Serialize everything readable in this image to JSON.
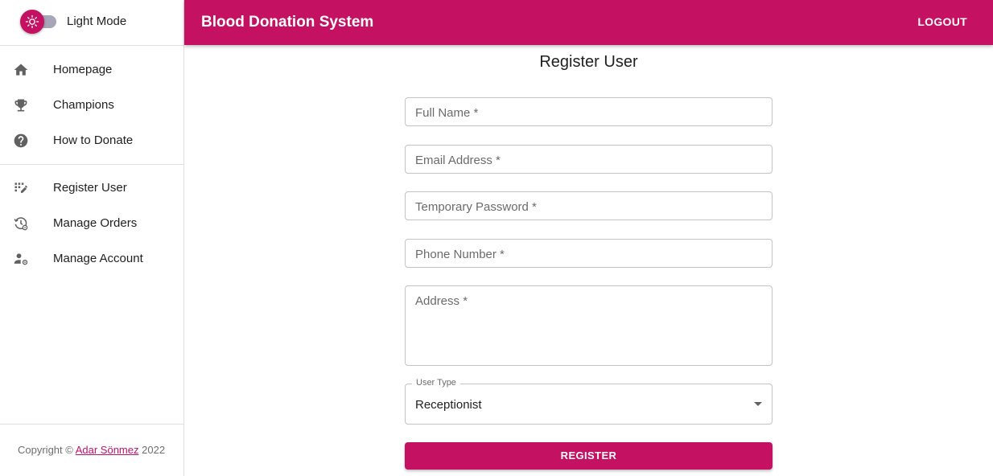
{
  "theme": {
    "label": "Light Mode",
    "icon": "sun-icon"
  },
  "sidebar": {
    "primary_items": [
      {
        "label": "Homepage",
        "icon": "home-icon"
      },
      {
        "label": "Champions",
        "icon": "trophy-icon"
      },
      {
        "label": "How to Donate",
        "icon": "help-circle-icon"
      }
    ],
    "secondary_items": [
      {
        "label": "Register User",
        "icon": "app-registration-icon"
      },
      {
        "label": "Manage Orders",
        "icon": "history-settings-icon"
      },
      {
        "label": "Manage Account",
        "icon": "user-settings-icon"
      }
    ]
  },
  "footer": {
    "prefix": "Copyright ©",
    "author": "Adar Sönmez",
    "year": "2022"
  },
  "appbar": {
    "title": "Blood Donation System",
    "logout_label": "LOGOUT"
  },
  "form": {
    "title": "Register User",
    "fields": {
      "full_name": {
        "placeholder": "Full Name *",
        "value": ""
      },
      "email": {
        "placeholder": "Email Address *",
        "value": ""
      },
      "password": {
        "placeholder": "Temporary Password *",
        "value": ""
      },
      "phone": {
        "placeholder": "Phone Number *",
        "value": ""
      },
      "address": {
        "placeholder": "Address *",
        "value": ""
      }
    },
    "user_type": {
      "label": "User Type",
      "selected": "Receptionist"
    },
    "submit_label": "REGISTER"
  },
  "colors": {
    "primary": "#c51162",
    "toggle_track": "#a6a6b8",
    "icon_gray": "#616161"
  }
}
